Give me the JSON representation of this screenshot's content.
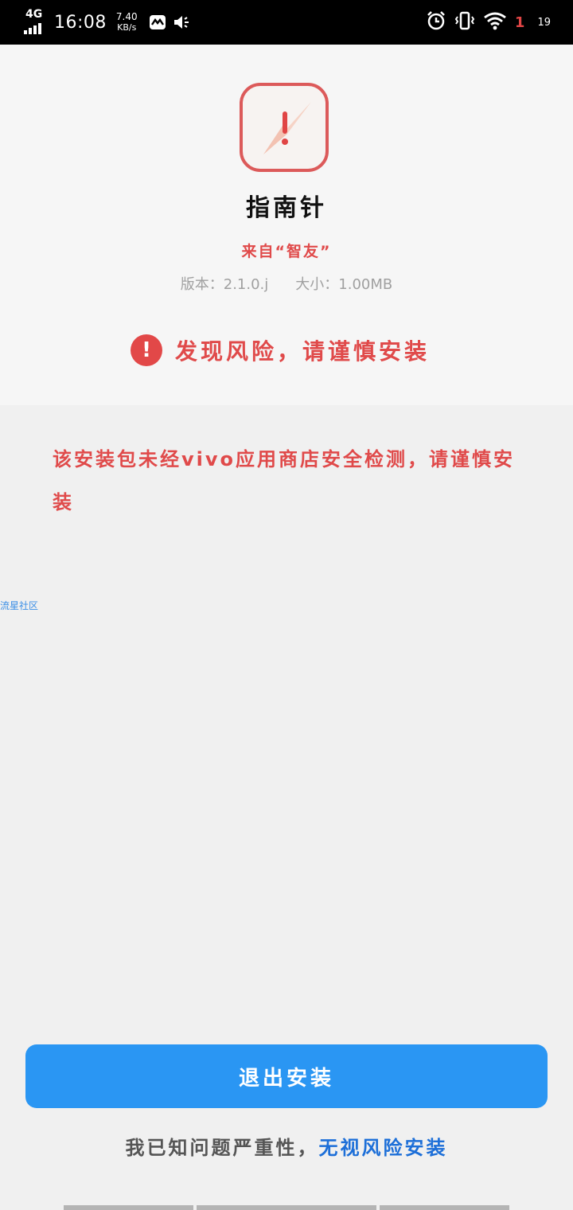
{
  "status_bar": {
    "network": "4G",
    "time": "16:08",
    "speed_value": "7.40",
    "speed_unit": "KB/s",
    "alert_badge": "1",
    "battery": "19",
    "icons": [
      "mail-icon",
      "volume-icon",
      "alarm-icon",
      "vibrate-icon",
      "wifi-icon"
    ]
  },
  "app": {
    "name": "指南针",
    "source": "来自“智友”",
    "version": "版本：2.1.0.j",
    "size": "大小：1.00MB",
    "icon": "compass-warning-icon",
    "icon_border_color": "#dc5a5a"
  },
  "warning": {
    "icon": "!",
    "text": "发现风险，请谨慎安装",
    "color": "#e24848"
  },
  "notice_text": "该安装包未经vivo应用商店安全检测，请谨慎安装",
  "watermark": "流星社区",
  "actions": {
    "exit_label": "退出安装",
    "exit_color": "#2a96f3",
    "ignore_prefix": "我已知问题严重性，",
    "ignore_link": "无视风险安装",
    "link_color": "#1d6fd8"
  }
}
